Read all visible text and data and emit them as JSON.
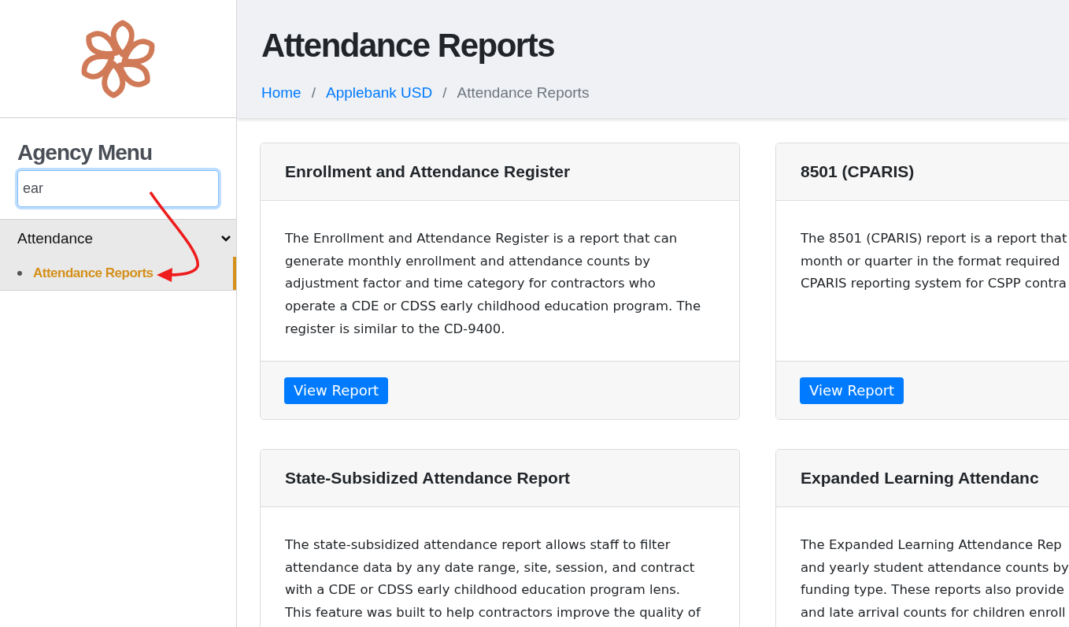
{
  "sidebar": {
    "title": "Agency Menu",
    "search": {
      "value": "ear"
    },
    "groups": [
      {
        "label": "Attendance",
        "expanded": true,
        "children": [
          {
            "label": "Attendance Reports",
            "selected": true
          }
        ]
      }
    ]
  },
  "header": {
    "title": "Attendance Reports",
    "breadcrumbs": [
      {
        "label": "Home",
        "kind": "link"
      },
      {
        "label": "/",
        "kind": "separator"
      },
      {
        "label": "Applebank USD",
        "kind": "link"
      },
      {
        "label": "/",
        "kind": "separator"
      },
      {
        "label": "Attendance Reports",
        "kind": "current"
      }
    ]
  },
  "cards": [
    {
      "title": "Enrollment and Attendance Register",
      "lines": [
        "The Enrollment and Attendance Register is a report that can",
        "generate monthly enrollment and attendance counts by",
        "adjustment factor and time category for contractors who",
        "operate a CDE or CDSS early childhood education program. The",
        "register is similar to the CD-9400."
      ],
      "button": "View Report"
    },
    {
      "title": "8501 (CPARIS)",
      "lines": [
        "The 8501 (CPARIS) report is a report that",
        "month or quarter in the format required",
        "CPARIS reporting system for CSPP contra"
      ],
      "button": "View Report"
    },
    {
      "title": "State-Subsidized Attendance Report",
      "lines": [
        "The state-subsidized attendance report allows staff to filter",
        "attendance data by any date range, site, session, and contract",
        "with a CDE or CDSS early childhood education program lens.",
        "This feature was built to help contractors improve the quality of"
      ]
    },
    {
      "title": "Expanded Learning Attendanc",
      "lines": [
        "The Expanded Learning Attendance Rep",
        "and yearly student attendance counts by",
        "funding type. These reports also provide",
        "and late arrival counts for children enroll"
      ]
    }
  ]
}
